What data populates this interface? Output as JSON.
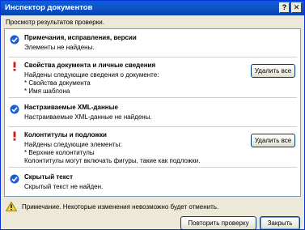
{
  "window": {
    "title": "Инспектор документов",
    "help_label": "?",
    "close_label": "✕"
  },
  "subtitle": "Просмотр результатов проверки.",
  "sections": [
    {
      "title": "Примечания, исправления, версии",
      "status": "ok",
      "icon": "checkmark-icon",
      "lines": [
        "Элементы не найдены."
      ]
    },
    {
      "title": "Свойства документа и личные сведения",
      "status": "found",
      "icon": "exclamation-icon",
      "lines": [
        "Найдены следующие сведения о документе:",
        "* Свойства документа",
        "* Имя шаблона"
      ],
      "button": "Удалить все"
    },
    {
      "title": "Настраиваемые XML-данные",
      "status": "ok",
      "icon": "checkmark-icon",
      "lines": [
        "Настраиваемые XML-данные не найдены."
      ]
    },
    {
      "title": "Колонтитулы и подложки",
      "status": "found",
      "icon": "exclamation-icon",
      "lines": [
        "Найдены следующие элементы:",
        "* Верхние колонтитулы",
        "Колонтитулы могут включать фигуры, такие как подложки."
      ],
      "button": "Удалить все"
    },
    {
      "title": "Скрытый текст",
      "status": "ok",
      "icon": "checkmark-icon",
      "lines": [
        "Скрытый текст не найден."
      ]
    }
  ],
  "footer": {
    "note": "Примечание. Некоторые изменения невозможно будет отменить.",
    "reinspect_label": "Повторить проверку",
    "close_label": "Закрыть"
  },
  "colors": {
    "ok": "#1a5fd0",
    "found": "#d01818",
    "titlebar": "#0a5fd8"
  }
}
